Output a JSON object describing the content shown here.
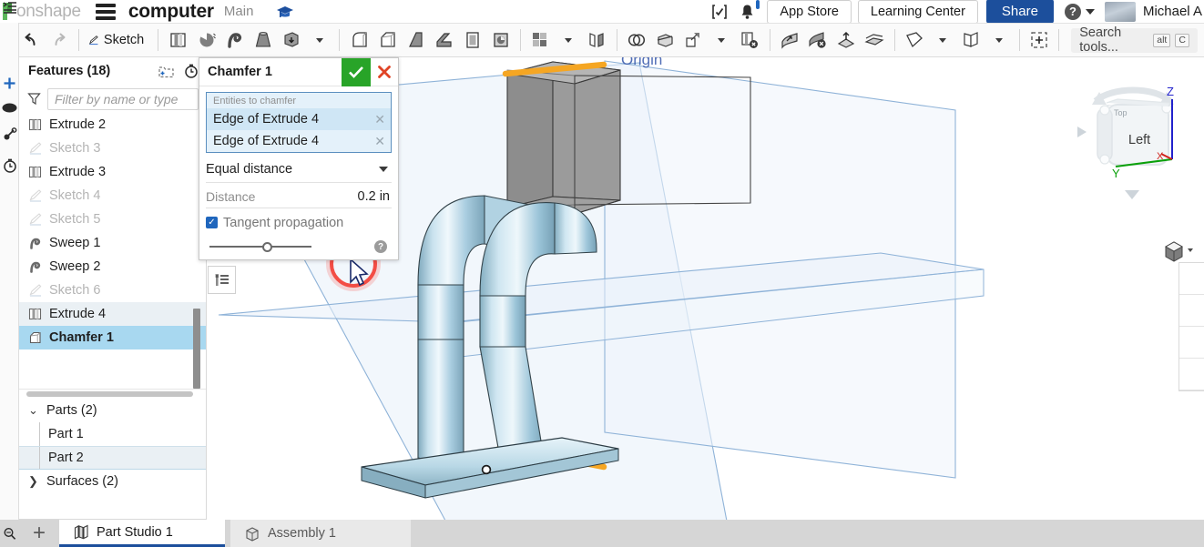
{
  "app": {
    "brand": "onshape",
    "document_title": "computer",
    "branch": "Main"
  },
  "topbar": {
    "app_store": "App Store",
    "learning_center": "Learning Center",
    "share": "Share",
    "user_name": "Michael A",
    "icons": {
      "hamburger": "hamburger-menu-icon",
      "graduation": "graduation-cap-icon",
      "versions": "version-check-icon",
      "bell": "notifications-bell-icon",
      "help": "help-question-icon",
      "avatar": "user-avatar"
    },
    "notification_count": ""
  },
  "toolbar": {
    "sketch_label": "Sketch",
    "search_placeholder": "Search tools...",
    "search_kbd_alt": "alt",
    "search_kbd_key": "C",
    "tools": [
      "undo-icon",
      "redo-icon",
      "sketch-icon",
      "extrude-icon",
      "revolve-icon",
      "sweep-icon",
      "loft-icon",
      "thicken-icon",
      "fillet-icon",
      "chamfer-icon",
      "draft-icon",
      "rib-icon",
      "shell-icon",
      "hole-icon",
      "pattern-icon",
      "mirror-icon",
      "boolean-icon",
      "split-icon",
      "transform-icon",
      "delete-face-icon",
      "move-face-icon",
      "delete-part-icon",
      "offset-surface-icon",
      "enclose-icon",
      "plane-icon",
      "curve-icon",
      "variable-icon"
    ]
  },
  "rail": {
    "icons": [
      "feature-list-icon",
      "insert-icon",
      "appearance-icon",
      "assembly-icon",
      "history-icon"
    ]
  },
  "features_panel": {
    "title": "Features (18)",
    "header_icons": [
      "add-folder-icon",
      "rollback-timer-icon"
    ],
    "filter_placeholder": "Filter by name or type",
    "items": [
      {
        "label": "Extrude 2",
        "icon": "extrude-icon",
        "state": "normal"
      },
      {
        "label": "Sketch 3",
        "icon": "sketch-icon",
        "state": "dim"
      },
      {
        "label": "Extrude 3",
        "icon": "extrude-icon",
        "state": "normal"
      },
      {
        "label": "Sketch 4",
        "icon": "sketch-icon",
        "state": "dim"
      },
      {
        "label": "Sketch 5",
        "icon": "sketch-icon",
        "state": "dim"
      },
      {
        "label": "Sweep 1",
        "icon": "sweep-icon",
        "state": "normal"
      },
      {
        "label": "Sweep 2",
        "icon": "sweep-icon",
        "state": "normal"
      },
      {
        "label": "Sketch 6",
        "icon": "sketch-icon",
        "state": "dim"
      },
      {
        "label": "Extrude 4",
        "icon": "extrude-icon",
        "state": "hover"
      },
      {
        "label": "Chamfer 1",
        "icon": "chamfer-icon",
        "state": "selected"
      }
    ],
    "tree": [
      {
        "label": "Parts (2)",
        "chevron": "chevron-down-icon",
        "level": 0,
        "highlight": false
      },
      {
        "label": "Part 1",
        "chevron": "",
        "level": 1,
        "highlight": false
      },
      {
        "label": "Part 2",
        "chevron": "",
        "level": 1,
        "highlight": true
      },
      {
        "label": "Surfaces (2)",
        "chevron": "chevron-right-icon",
        "level": 0,
        "highlight": false
      }
    ]
  },
  "chamfer_dialog": {
    "title": "Chamfer 1",
    "confirm_icon": "checkmark-icon",
    "cancel_icon": "close-x-icon",
    "entities_hint": "Entities to chamfer",
    "entities": [
      {
        "label": "Edge of Extrude 4",
        "remove_icon": "remove-x-icon"
      },
      {
        "label": "Edge of Extrude 4",
        "remove_icon": "remove-x-icon"
      }
    ],
    "chamfer_type": "Equal distance",
    "distance_label": "Distance",
    "distance_value": "0.2 in",
    "tangent_propagation_label": "Tangent propagation",
    "tangent_propagation_checked": true,
    "help_icon": "help-question-icon"
  },
  "viewport": {
    "view_cube_face": "Left",
    "axes": {
      "x": "X",
      "y": "Y",
      "z": "Z"
    },
    "axis_colors": {
      "x": "#d0231c",
      "y": "#0aa00a",
      "z": "#2222cc"
    },
    "selection_color": "#f5a623",
    "part_color": "#a9cfe0",
    "plane_color": "#7ba7d7",
    "cursor_ring_color": "#f4443c",
    "list_button_icon": "measure-list-icon",
    "display_cube_icon": "display-style-cube-icon"
  },
  "tabs": {
    "zoom_icon": "zoom-fit-icon",
    "add_tab_label": "+",
    "items": [
      {
        "label": "Part Studio 1",
        "icon": "part-studio-icon",
        "active": true
      },
      {
        "label": "Assembly 1",
        "icon": "assembly-icon",
        "active": false
      }
    ]
  }
}
